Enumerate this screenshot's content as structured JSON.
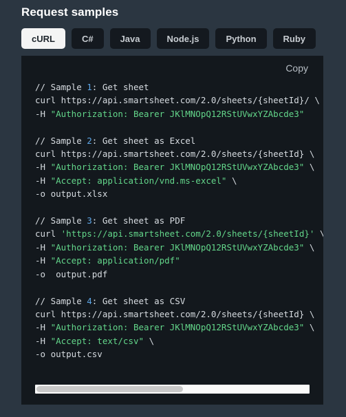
{
  "header": {
    "title": "Request samples"
  },
  "tabs": {
    "active_index": 0,
    "items": [
      {
        "label": "cURL"
      },
      {
        "label": "C#"
      },
      {
        "label": "Java"
      },
      {
        "label": "Node.js"
      },
      {
        "label": "Python"
      },
      {
        "label": "Ruby"
      }
    ]
  },
  "code_panel": {
    "copy_label": "Copy",
    "language": "cURL",
    "scrollbar": {
      "orientation": "horizontal",
      "thumb_fraction_percent": 54
    },
    "lines": [
      [
        {
          "t": "// Sample ",
          "c": "comment"
        },
        {
          "t": "1",
          "c": "num"
        },
        {
          "t": ": Get sheet",
          "c": "comment"
        }
      ],
      [
        {
          "t": "curl https://api.smartsheet.com/2.0/sheets/{sheetId}/ \\",
          "c": "plain"
        }
      ],
      [
        {
          "t": "-H ",
          "c": "plain"
        },
        {
          "t": "\"Authorization: Bearer JKlMNOpQ12RStUVwxYZAbcde3\"",
          "c": "str"
        }
      ],
      [
        {
          "t": "",
          "c": "plain"
        }
      ],
      [
        {
          "t": "// Sample ",
          "c": "comment"
        },
        {
          "t": "2",
          "c": "num"
        },
        {
          "t": ": Get sheet as Excel",
          "c": "comment"
        }
      ],
      [
        {
          "t": "curl https://api.smartsheet.com/2.0/sheets/{sheetId} \\",
          "c": "plain"
        }
      ],
      [
        {
          "t": "-H ",
          "c": "plain"
        },
        {
          "t": "\"Authorization: Bearer JKlMNOpQ12RStUVwxYZAbcde3\"",
          "c": "str"
        },
        {
          "t": " \\",
          "c": "plain"
        }
      ],
      [
        {
          "t": "-H ",
          "c": "plain"
        },
        {
          "t": "\"Accept: application/vnd.ms-excel\"",
          "c": "str"
        },
        {
          "t": " \\",
          "c": "plain"
        }
      ],
      [
        {
          "t": "-o output.xlsx",
          "c": "plain"
        }
      ],
      [
        {
          "t": "",
          "c": "plain"
        }
      ],
      [
        {
          "t": "// Sample ",
          "c": "comment"
        },
        {
          "t": "3",
          "c": "num"
        },
        {
          "t": ": Get sheet as PDF",
          "c": "comment"
        }
      ],
      [
        {
          "t": "curl ",
          "c": "plain"
        },
        {
          "t": "'https://api.smartsheet.com/2.0/sheets/{sheetId}'",
          "c": "str"
        },
        {
          "t": " \\",
          "c": "plain"
        }
      ],
      [
        {
          "t": "-H ",
          "c": "plain"
        },
        {
          "t": "\"Authorization: Bearer JKlMNOpQ12RStUVwxYZAbcde3\"",
          "c": "str"
        },
        {
          "t": " \\",
          "c": "plain"
        }
      ],
      [
        {
          "t": "-H ",
          "c": "plain"
        },
        {
          "t": "\"Accept: application/pdf\"",
          "c": "str"
        }
      ],
      [
        {
          "t": "-o  output.pdf",
          "c": "plain"
        }
      ],
      [
        {
          "t": "",
          "c": "plain"
        }
      ],
      [
        {
          "t": "// Sample ",
          "c": "comment"
        },
        {
          "t": "4",
          "c": "num"
        },
        {
          "t": ": Get sheet as CSV",
          "c": "comment"
        }
      ],
      [
        {
          "t": "curl https://api.smartsheet.com/2.0/sheets/{sheetId} \\",
          "c": "plain"
        }
      ],
      [
        {
          "t": "-H ",
          "c": "plain"
        },
        {
          "t": "\"Authorization: Bearer JKlMNOpQ12RStUVwxYZAbcde3\"",
          "c": "str"
        },
        {
          "t": " \\",
          "c": "plain"
        }
      ],
      [
        {
          "t": "-H ",
          "c": "plain"
        },
        {
          "t": "\"Accept: text/csv\"",
          "c": "str"
        },
        {
          "t": " \\",
          "c": "plain"
        }
      ],
      [
        {
          "t": "-o output.csv",
          "c": "plain"
        }
      ]
    ]
  },
  "colors": {
    "page_background": "#2b3641",
    "code_background": "#13181d",
    "tab_inactive_bg": "#14191f",
    "tab_active_bg": "#f4f4f4",
    "string_green": "#63d68a",
    "number_blue": "#5ea7e8",
    "text_light": "#d6dbe0"
  }
}
